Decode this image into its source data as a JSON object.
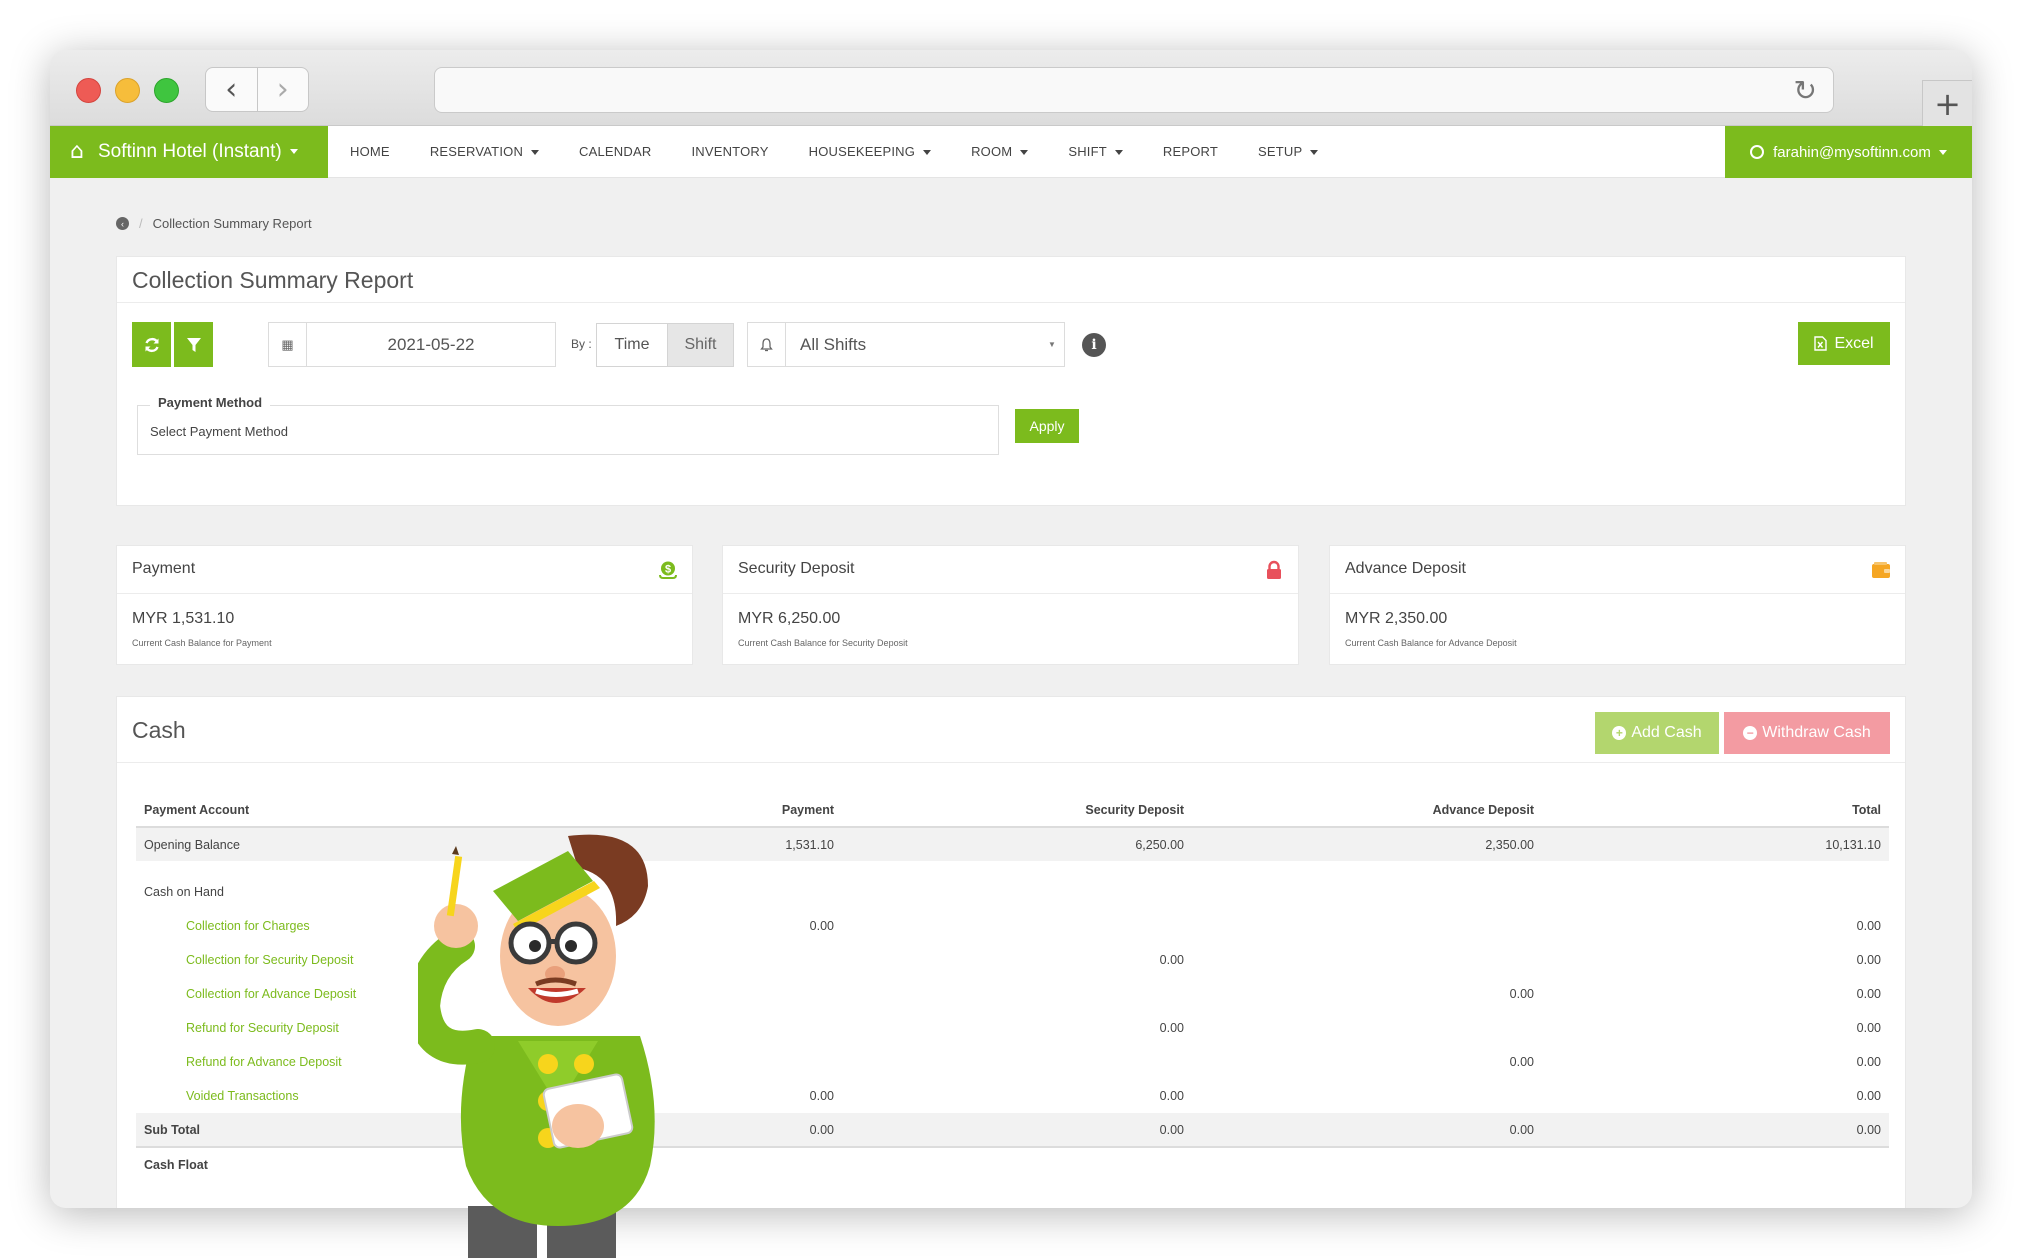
{
  "browser": {
    "reload_icon": "reload-icon",
    "new_tab_icon": "plus-icon"
  },
  "nav": {
    "brand": "Softinn Hotel (Instant)",
    "items": [
      {
        "label": "HOME",
        "dropdown": false
      },
      {
        "label": "RESERVATION",
        "dropdown": true
      },
      {
        "label": "CALENDAR",
        "dropdown": false
      },
      {
        "label": "INVENTORY",
        "dropdown": false
      },
      {
        "label": "HOUSEKEEPING",
        "dropdown": true
      },
      {
        "label": "ROOM",
        "dropdown": true
      },
      {
        "label": "SHIFT",
        "dropdown": true
      },
      {
        "label": "REPORT",
        "dropdown": false
      },
      {
        "label": "SETUP",
        "dropdown": true
      }
    ],
    "user": "farahin@mysoftinn.com"
  },
  "breadcrumb": {
    "current": "Collection Summary Report"
  },
  "report": {
    "title": "Collection Summary Report",
    "date": "2021-05-22",
    "by_label": "By :",
    "toggle": [
      "Time",
      "Shift"
    ],
    "toggle_active": "Shift",
    "shift_select": "All Shifts",
    "excel_label": "Excel",
    "payment_method_label": "Payment Method",
    "payment_method_value": "Select Payment Method",
    "apply_label": "Apply"
  },
  "cards": [
    {
      "title": "Payment",
      "amount": "MYR 1,531.10",
      "subtitle": "Current Cash Balance for Payment",
      "icon": "dollar-icon",
      "color": "#7cbb1d"
    },
    {
      "title": "Security Deposit",
      "amount": "MYR 6,250.00",
      "subtitle": "Current Cash Balance for Security Deposit",
      "icon": "lock-icon",
      "color": "#e8505b"
    },
    {
      "title": "Advance Deposit",
      "amount": "MYR 2,350.00",
      "subtitle": "Current Cash Balance for Advance Deposit",
      "icon": "wallet-icon",
      "color": "#f5a623"
    }
  ],
  "cash": {
    "title": "Cash",
    "add_label": "Add Cash",
    "withdraw_label": "Withdraw Cash",
    "columns": [
      "Payment Account",
      "Payment",
      "Security Deposit",
      "Advance Deposit",
      "Total"
    ],
    "rows": [
      {
        "cells": [
          "Opening Balance",
          "1,531.10",
          "6,250.00",
          "2,350.00",
          "10,131.10"
        ],
        "style": "shade"
      },
      {
        "cells": [
          "Cash on Hand",
          "",
          "",
          "",
          ""
        ],
        "style": "gap"
      },
      {
        "cells": [
          "Collection for Charges",
          "0.00",
          "",
          "",
          "0.00"
        ],
        "style": "sub"
      },
      {
        "cells": [
          "Collection for Security Deposit",
          "",
          "0.00",
          "",
          "0.00"
        ],
        "style": "sub"
      },
      {
        "cells": [
          "Collection for Advance Deposit",
          "",
          "",
          "0.00",
          "0.00"
        ],
        "style": "sub"
      },
      {
        "cells": [
          "Refund for Security Deposit",
          "",
          "0.00",
          "",
          "0.00"
        ],
        "style": "sub"
      },
      {
        "cells": [
          "Refund for Advance Deposit",
          "",
          "",
          "0.00",
          "0.00"
        ],
        "style": "sub"
      },
      {
        "cells": [
          "Voided Transactions",
          "0.00",
          "0.00",
          "",
          "0.00"
        ],
        "style": "sub"
      },
      {
        "cells": [
          "Sub Total",
          "0.00",
          "0.00",
          "0.00",
          "0.00"
        ],
        "style": "shade bold sum"
      },
      {
        "cells": [
          "Cash Float",
          "",
          "",
          "",
          ""
        ],
        "style": "bold"
      }
    ]
  },
  "mascot": {
    "description_icon": "bellboy-mascot-icon"
  }
}
